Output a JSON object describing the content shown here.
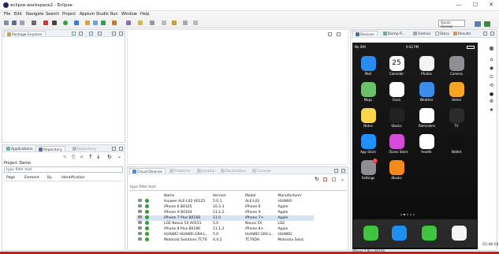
{
  "window": {
    "title": "eclipse-workspace2 - Eclipse",
    "minimize": "—",
    "maximize": "☐",
    "close": "✕"
  },
  "menu": [
    "File",
    "Edit",
    "Navigate",
    "Search",
    "Project",
    "Appium Studio",
    "Run",
    "Window",
    "Help"
  ],
  "quick_access": "Quick Access",
  "package_explorer": {
    "tab": "Package Explorer"
  },
  "lower_left": {
    "tabs": [
      "Applications",
      "Repository",
      "Repository"
    ],
    "project_label": "Project: Demo",
    "filter_placeholder": "type filter text",
    "columns": [
      "Page",
      "Element",
      "By",
      "Identification"
    ]
  },
  "bottom": {
    "tabs": [
      "Cloud Devices",
      "Problems",
      "Javadoc",
      "Declaration",
      "Console"
    ],
    "filter_placeholder": "type filter text",
    "columns": [
      "Name",
      "Version",
      "Model",
      "Manufacturer"
    ],
    "rows": [
      {
        "name": "Huawei ALE-L02 A0125",
        "version": "5.0.1",
        "model": "ALE-L02",
        "manufacturer": "HUAWEI"
      },
      {
        "name": "iPhone 6 B0105",
        "version": "10.3.3",
        "model": "iPhone 6",
        "manufacturer": "Apple"
      },
      {
        "name": "iPhone X B0164",
        "version": "11.1.2",
        "model": "iPhone X",
        "manufacturer": "Apple"
      },
      {
        "name": "iPhone 7 Plus B0168",
        "version": "11.0",
        "model": "iPhone 7+",
        "manufacturer": "Apple",
        "selected": true
      },
      {
        "name": "LGE Nexus 5X A0151",
        "version": "5.0",
        "model": "Nexus 5X",
        "manufacturer": "LGE"
      },
      {
        "name": "iPhone 8 Plus B0166",
        "version": "11.1.2",
        "model": "iPhone 8+",
        "manufacturer": "Apple"
      },
      {
        "name": "HUAWEI HUAWEI GRA-L...",
        "version": "5.0",
        "model": "HUAWEI GRA-L...",
        "manufacturer": "HUAWEI"
      },
      {
        "name": "Motorola Solutions TC70",
        "version": "4.4.2",
        "model": "TC70DH",
        "manufacturer": "Motorola Solut"
      }
    ]
  },
  "right_tabs": [
    "Devices",
    "Dump P...",
    "Outline",
    "Story",
    "Results"
  ],
  "phone": {
    "carrier": "No SIM",
    "time": "9:42 PM",
    "apps": [
      {
        "label": "Mail",
        "color": "#2a8cf0"
      },
      {
        "label": "Calendar",
        "color": "#ffffff",
        "glyph": "25"
      },
      {
        "label": "Photos",
        "color": "#f4f4f4"
      },
      {
        "label": "Camera",
        "color": "#8e8e93"
      },
      {
        "label": "Maps",
        "color": "#6cc06a"
      },
      {
        "label": "Clock",
        "color": "#ffffff"
      },
      {
        "label": "Weather",
        "color": "#3b8ee8"
      },
      {
        "label": "Home",
        "color": "#f6a623"
      },
      {
        "label": "Notes",
        "color": "#f8d54b"
      },
      {
        "label": "Stocks",
        "color": "#222222"
      },
      {
        "label": "Reminders",
        "color": "#ffffff"
      },
      {
        "label": "TV",
        "color": "#2b2b2b"
      },
      {
        "label": "App Store",
        "color": "#1e90ff"
      },
      {
        "label": "iTunes Store",
        "color": "#d64ad8"
      },
      {
        "label": "Health",
        "color": "#ffffff"
      },
      {
        "label": "Wallet",
        "color": "#111111"
      },
      {
        "label": "Settings",
        "color": "#8e8e93",
        "badge": "1"
      },
      {
        "label": "iBooks",
        "color": "#f28a1c"
      }
    ],
    "dock": [
      {
        "name": "phone",
        "color": "#3ec43e"
      },
      {
        "name": "safari",
        "color": "#1f8ef1"
      },
      {
        "name": "messages",
        "color": "#3ec43e"
      },
      {
        "name": "music",
        "color": "#f5f5f5"
      }
    ],
    "footer_label": "iPhone 7 Plus B0168",
    "footer_time": "01:48:58"
  }
}
